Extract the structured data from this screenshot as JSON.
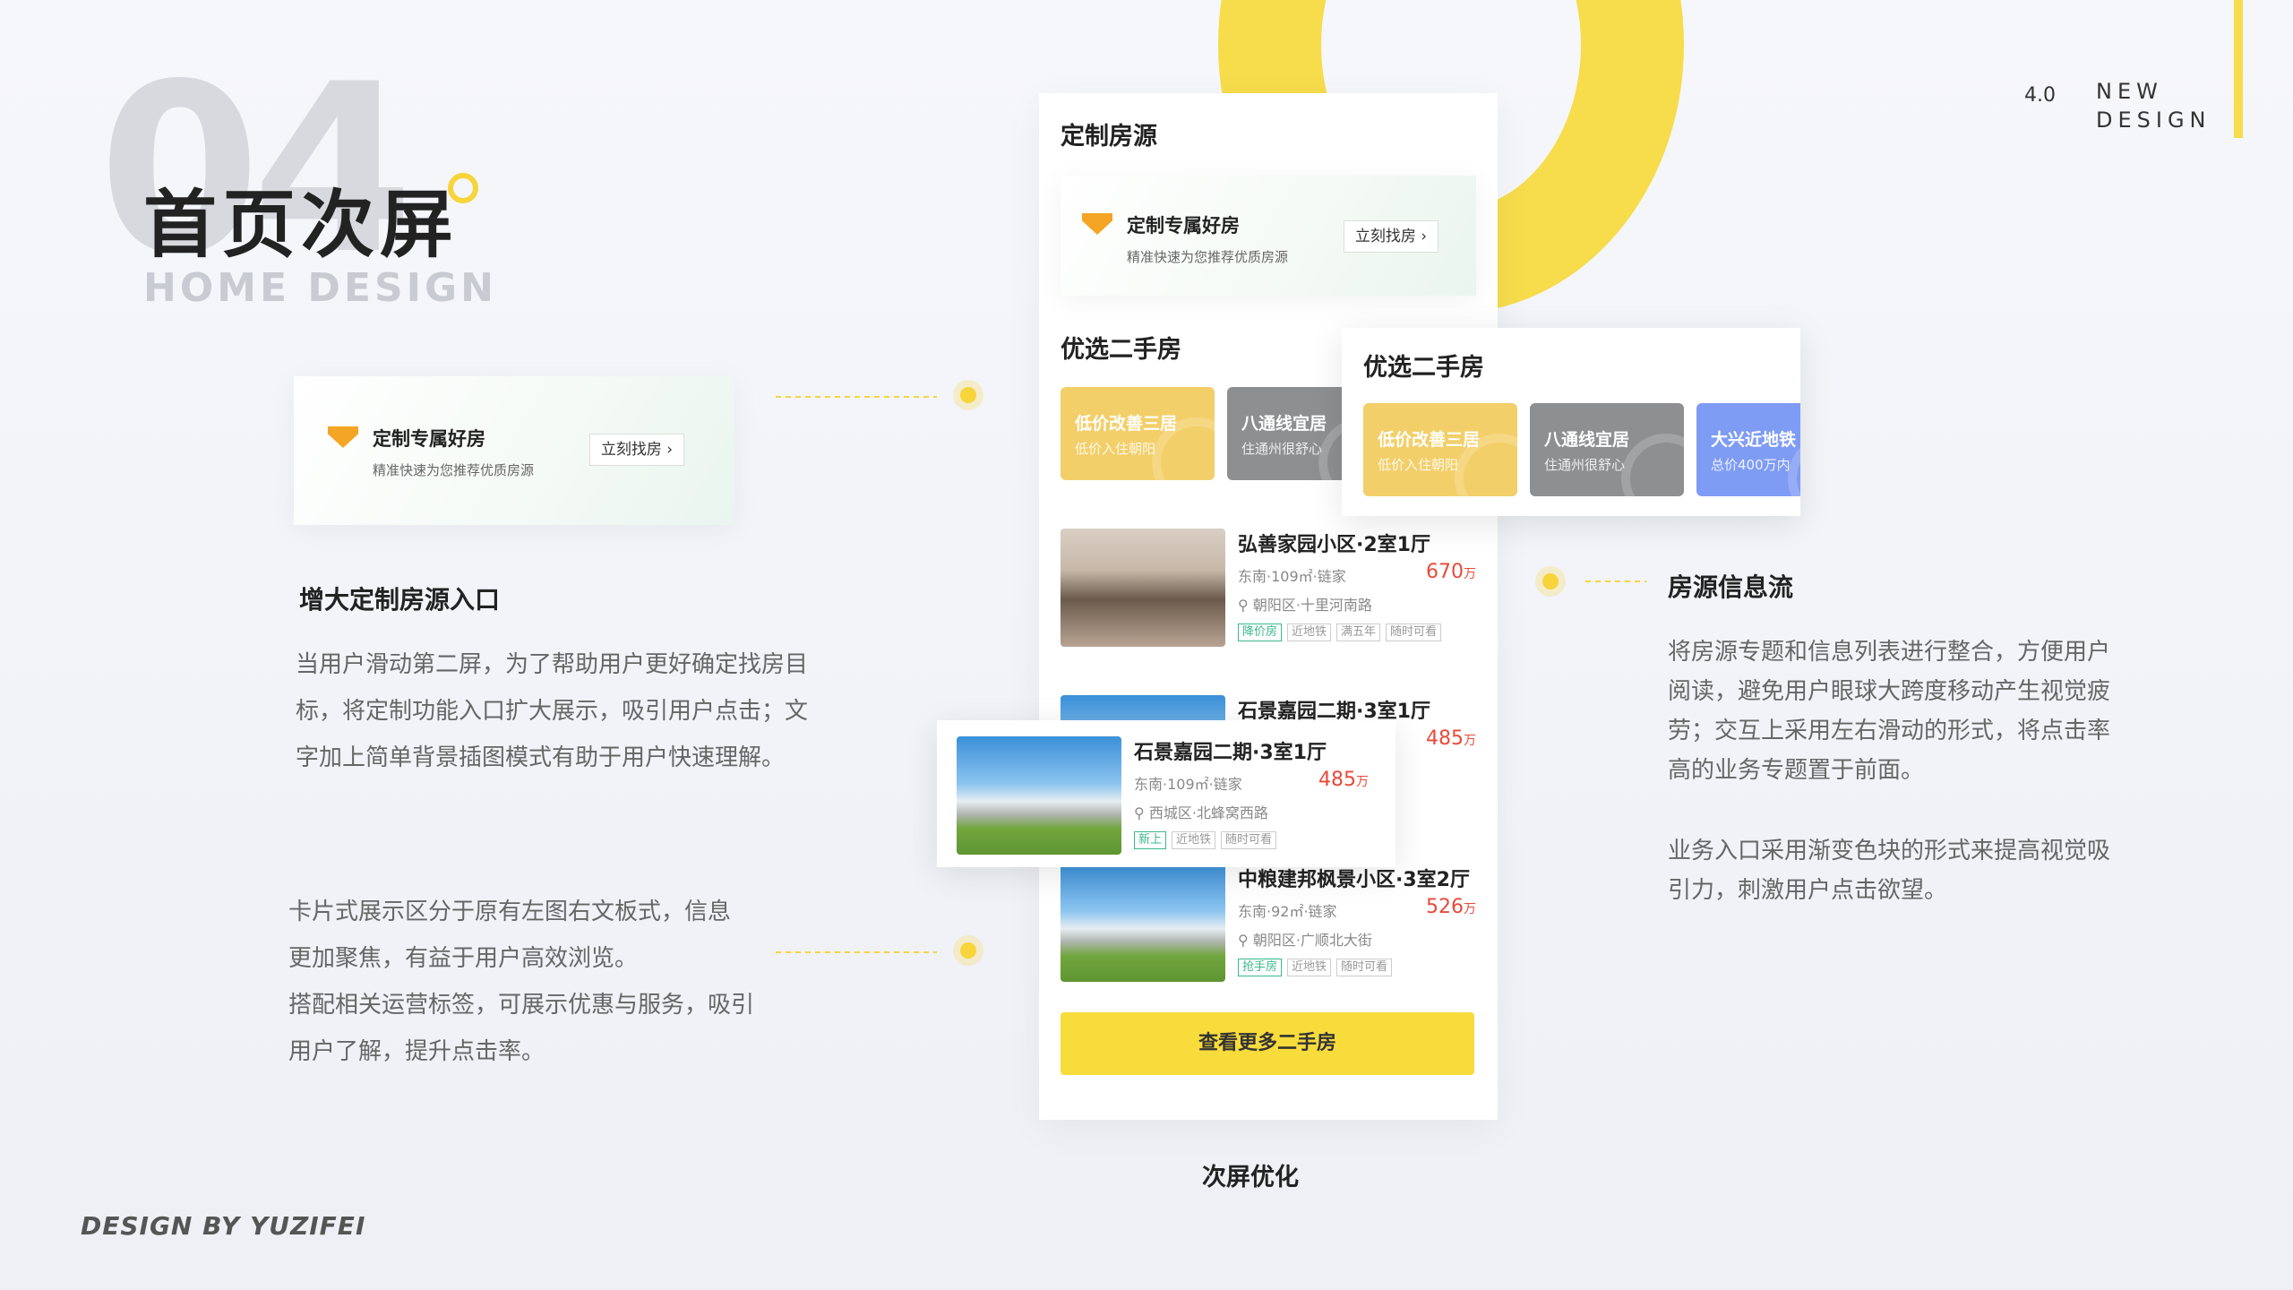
{
  "header": {
    "big_number": "04",
    "title": "首页次屏",
    "subtitle": "HOME DESIGN",
    "version": "4.0",
    "new_design": "NEW DESIGN"
  },
  "banner": {
    "title": "定制专属好房",
    "subtitle": "精准快速为您推荐优质房源",
    "button": "立刻找房 ›"
  },
  "left_section1": {
    "heading": "增大定制房源入口",
    "text": [
      "当用户滑动第二屏，为了帮助用户更好确定找房目",
      "标，将定制功能入口扩大展示，吸引用户点击；文",
      "字加上简单背景插图模式有助于用户快速理解。"
    ]
  },
  "left_section2": {
    "text": [
      "卡片式展示区分于原有左图右文板式，信息",
      "更加聚焦，有益于用户高效浏览。",
      "搭配相关运营标签，可展示优惠与服务，吸引",
      "用户了解，提升点击率。"
    ]
  },
  "right_section": {
    "heading": "房源信息流",
    "para1": [
      "将房源专题和信息列表进行整合，方便用户",
      "阅读，避免用户眼球大跨度移动产生视觉疲",
      "劳；交互上采用左右滑动的形式，将点击率",
      "高的业务专题置于前面。"
    ],
    "para2": [
      "业务入口采用渐变色块的形式来提高视觉吸",
      "引力，刺激用户点击欲望。"
    ]
  },
  "phone": {
    "custom_title": "定制房源",
    "second_hand_title": "优选二手房",
    "tiles": [
      {
        "t1": "低价改善三居",
        "t2": "低价入住朝阳",
        "color": "#f3cf6a"
      },
      {
        "t1": "八通线宜居",
        "t2": "住通州很舒心",
        "color": "#8d8f90"
      },
      {
        "t1": "大兴近地铁",
        "t2": "总价400万内",
        "color": "#7f9cf4"
      }
    ],
    "listings": [
      {
        "title": "弘善家园小区·2室1厅",
        "info": "东南·109㎡·链家",
        "price": "670",
        "unit": "万",
        "loc": "朝阳区·十里河南路",
        "tags": [
          "降价房",
          "近地铁",
          "满五年",
          "随时可看"
        ]
      },
      {
        "title": "石景嘉园二期·3室1厅",
        "info": "东南·109㎡·链家",
        "price": "485",
        "unit": "万",
        "loc": "西城区·北蜂窝西路",
        "tags": [
          "新上",
          "近地铁",
          "随时可看"
        ]
      },
      {
        "title": "中粮建邦枫景小区·3室2厅",
        "info": "东南·92㎡·链家",
        "price": "526",
        "unit": "万",
        "loc": "朝阳区·广顺北大街",
        "tags": [
          "抢手房",
          "近地铁",
          "随时可看"
        ]
      }
    ],
    "more_button": "查看更多二手房"
  },
  "caption": "次屏优化",
  "footer": "DESIGN BY YUZIFEI"
}
